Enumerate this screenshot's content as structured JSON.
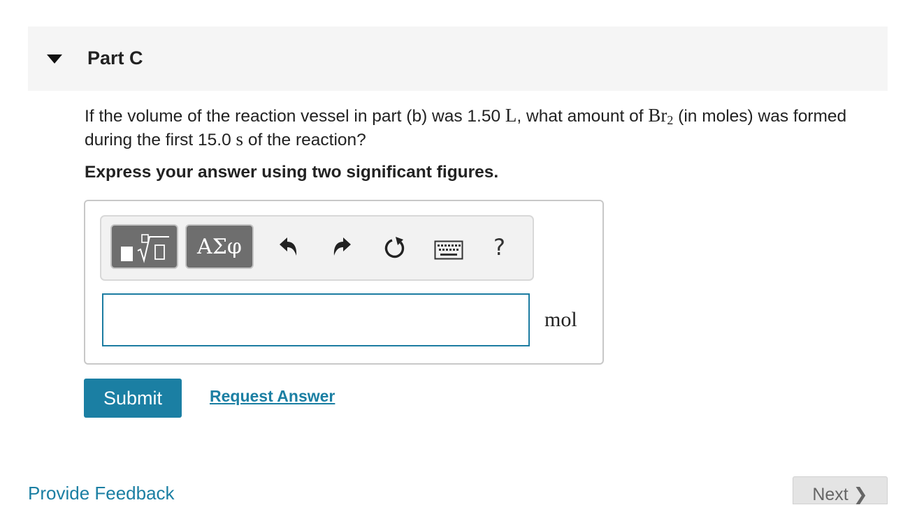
{
  "part": {
    "title": "Part C",
    "toggle_icon": "triangle-down-icon"
  },
  "question": {
    "text_1": "If the volume of the reaction vessel in part (b) was 1.50 ",
    "unit_L": "L",
    "text_2": ", what amount of ",
    "formula_base": "Br",
    "formula_sub": "2",
    "text_3": " (in moles) was formed during the first 15.0 ",
    "unit_s": "s",
    "text_4": " of the reaction?"
  },
  "instruction": "Express your answer using two significant figures.",
  "toolbar": {
    "templates_icon": "templates-icon",
    "symbols_label": "ΑΣφ",
    "undo_icon": "undo-icon",
    "redo_icon": "redo-icon",
    "reset_icon": "reset-icon",
    "keyboard_icon": "keyboard-icon",
    "help_label": "?"
  },
  "answer": {
    "value": "",
    "placeholder": "",
    "unit": "mol"
  },
  "actions": {
    "submit_label": "Submit",
    "request_label": "Request Answer"
  },
  "footer": {
    "feedback_label": "Provide Feedback",
    "next_label": "Next ❯"
  },
  "colors": {
    "accent": "#1b7fa3",
    "header_bg": "#f5f5f5",
    "toolbar_button": "#6e6e6e"
  }
}
